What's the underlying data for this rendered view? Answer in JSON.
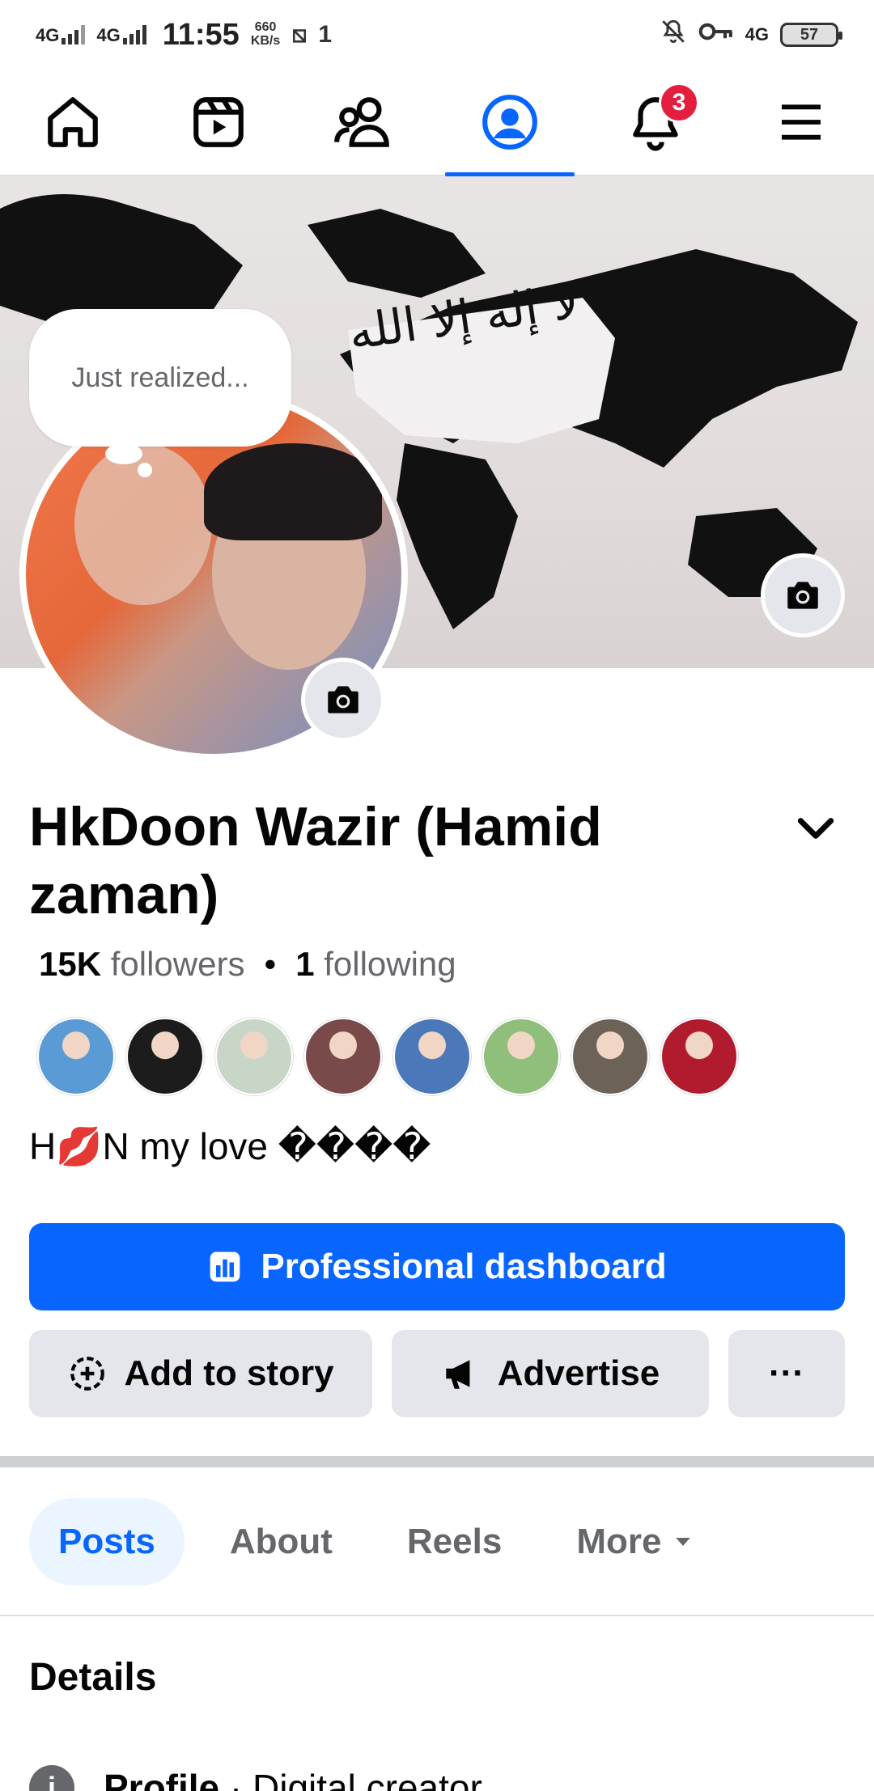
{
  "status_bar": {
    "net1": "4G",
    "net2": "4G",
    "time": "11:55",
    "speed_value": "660",
    "speed_unit": "KB/s",
    "extra": "1",
    "net3": "4G",
    "battery": "57"
  },
  "nav": {
    "notifications_badge": "3"
  },
  "cover": {
    "note_text": "Just realized..."
  },
  "profile": {
    "name": "HkDoon Wazir (Hamid zaman)",
    "followers_count": "15K",
    "followers_label": "followers",
    "following_count": "1",
    "following_label": "following",
    "bio": "H💋N my love ����"
  },
  "friends": [
    {
      "color": "#5b9bd5"
    },
    {
      "color": "#1c1c1c"
    },
    {
      "color": "#c8d6c8"
    },
    {
      "color": "#7a4a4a"
    },
    {
      "color": "#4a78b8"
    },
    {
      "color": "#8fbf7a"
    },
    {
      "color": "#6d6258"
    },
    {
      "color": "#b01c2e"
    }
  ],
  "actions": {
    "professional_dashboard": "Professional dashboard",
    "add_to_story": "Add to story",
    "advertise": "Advertise",
    "more_dots": "···"
  },
  "tabs": [
    {
      "label": "Posts"
    },
    {
      "label": "About"
    },
    {
      "label": "Reels"
    },
    {
      "label": "More"
    }
  ],
  "details": {
    "heading": "Details",
    "profile_label": "Profile",
    "profile_value": " · Digital creator"
  }
}
